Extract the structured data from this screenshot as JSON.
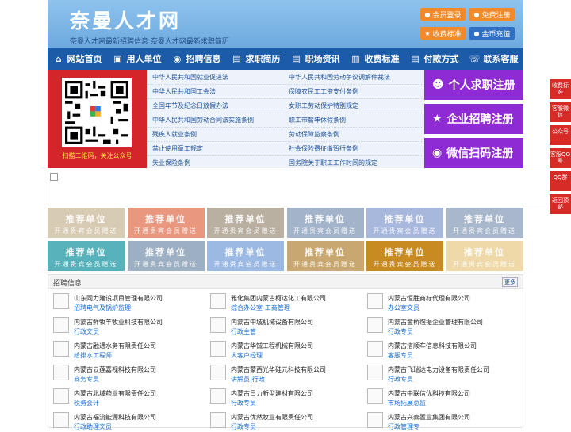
{
  "site": {
    "title": "奈曼人才网",
    "slogan": "奈曼人才网最新招聘信息   奈曼人才网最新求职简历"
  },
  "header_buttons": [
    {
      "label": "会员登录",
      "icon": "user-icon",
      "color": "#f28a2a"
    },
    {
      "label": "免费注册",
      "icon": "register-icon",
      "color": "#f28a2a"
    },
    {
      "label": "收费标准",
      "icon": "price-icon",
      "color": "#f28a2a"
    },
    {
      "label": "金币充值",
      "icon": "coin-icon",
      "color": "#2f6fc4"
    }
  ],
  "nav": [
    {
      "label": "网站首页",
      "icon": "home-icon"
    },
    {
      "label": "用人单位",
      "icon": "building-icon"
    },
    {
      "label": "招聘信息",
      "icon": "megaphone-icon"
    },
    {
      "label": "求职简历",
      "icon": "resume-icon"
    },
    {
      "label": "职场资讯",
      "icon": "news-icon"
    },
    {
      "label": "收费标准",
      "icon": "price-icon"
    },
    {
      "label": "付款方式",
      "icon": "payment-icon"
    },
    {
      "label": "联系客服",
      "icon": "phone-icon"
    }
  ],
  "qr": {
    "caption": "扫描二维码，关注公众号"
  },
  "laws": {
    "left": [
      "中华人民共和国就业促进法",
      "中华人民共和国工会法",
      "全国年节及纪念日放假办法",
      "中华人民共和国劳动合同法实施条例",
      "残疾人就业条例",
      "禁止使用童工规定",
      "失业保险条例"
    ],
    "right": [
      "中华人民共和国劳动争议调解仲裁法",
      "保障农民工工资支付条例",
      "女职工劳动保护特别规定",
      "职工带薪年休假条例",
      "劳动保障监察条例",
      "社会保险费征缴暂行条例",
      "国务院关于职工工作时间的规定"
    ]
  },
  "register": [
    {
      "label": "个人求职注册",
      "icon": "person-icon"
    },
    {
      "label": "企业招聘注册",
      "icon": "company-icon"
    },
    {
      "label": "微信扫码注册",
      "icon": "wechat-icon"
    }
  ],
  "tiles": {
    "line1": "推荐单位",
    "line2": "开通贵宾会员赠送",
    "colors": [
      "#d8cbb4",
      "#e9977f",
      "#b9b0a2",
      "#a3b3c9",
      "#a8b7dc",
      "#a8b7cb",
      "#58b2bb",
      "#9dafc2",
      "#9bb9e3",
      "#c8a870",
      "#c88b22",
      "#efd9a8"
    ]
  },
  "jobs": {
    "title": "招聘信息",
    "more": "更多",
    "items": [
      {
        "company": "山东同力建设项目管理有限公司",
        "position": "招聘电气及锅炉监理"
      },
      {
        "company": "雅化集团内蒙古柯达化工有限公司",
        "position": "综合办公室-工商管理"
      },
      {
        "company": "内蒙古恒胜商标代理有限公司",
        "position": "办公室文员"
      },
      {
        "company": "内蒙古鲜牧羊牧业科技有限公司",
        "position": "行政文员"
      },
      {
        "company": "内蒙古中城机械设备有限公司",
        "position": "行政主管"
      },
      {
        "company": "内蒙古金桥煜振企业管理有限公司",
        "position": "行政专员"
      },
      {
        "company": "内蒙古融通水务有限责任公司",
        "position": "给排水工程师"
      },
      {
        "company": "内蒙古华铖工程机械有限公司",
        "position": "大客户经理"
      },
      {
        "company": "内蒙古搭顺车信息科技有限公司",
        "position": "客服专员"
      },
      {
        "company": "内蒙古云莲嘉视科技有限公司",
        "position": "商务专员"
      },
      {
        "company": "内蒙古蒙西光华硅元科技有限公司",
        "position": "讲解员|行政"
      },
      {
        "company": "内蒙古飞瑞达电力设备有限责任公司",
        "position": "行政专员"
      },
      {
        "company": "内蒙古北域药业有限责任公司",
        "position": "税务会计"
      },
      {
        "company": "内蒙古日力新型建材有限公司",
        "position": "行政专员"
      },
      {
        "company": "内蒙古中联信优科技有限公司",
        "position": "市场拓展总监"
      },
      {
        "company": "内蒙古福流能源科技有限公司",
        "position": "行政助理文员"
      },
      {
        "company": "内蒙古优然牧业有限责任公司",
        "position": "行政专员"
      },
      {
        "company": "内蒙古兴泰置业集团有限公司",
        "position": "行政管理专"
      }
    ]
  },
  "sidebar": [
    "收费标准",
    "客服微信",
    "公众号",
    "客服QQ号",
    "QQ群",
    "返回顶部"
  ]
}
